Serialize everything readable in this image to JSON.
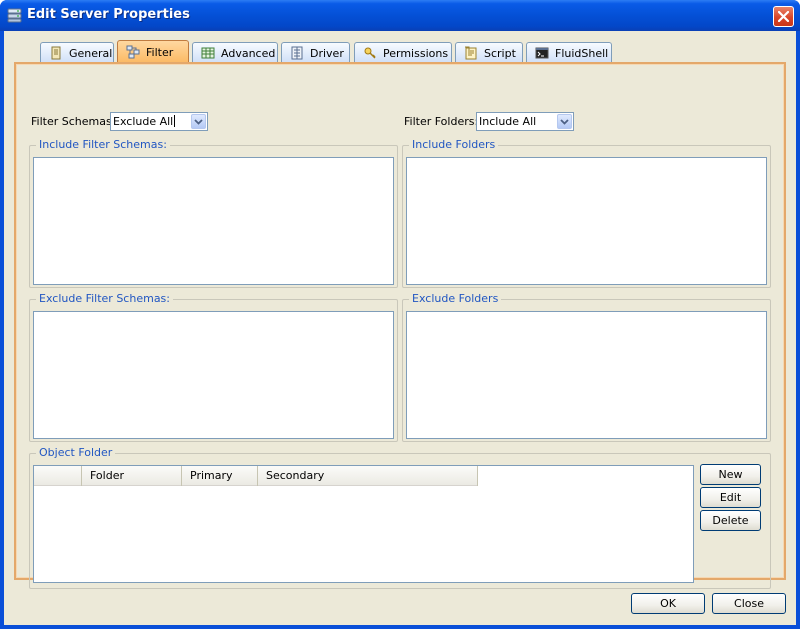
{
  "window": {
    "title": "Edit Server Properties"
  },
  "tabs": [
    {
      "label": "General",
      "icon": "general-icon"
    },
    {
      "label": "Filter",
      "icon": "filter-icon",
      "active": true
    },
    {
      "label": "Advanced",
      "icon": "advanced-icon"
    },
    {
      "label": "Driver",
      "icon": "driver-icon"
    },
    {
      "label": "Permissions",
      "icon": "permissions-icon"
    },
    {
      "label": "Script",
      "icon": "script-icon"
    },
    {
      "label": "FluidShell",
      "icon": "fluidshell-icon"
    }
  ],
  "filter": {
    "schemas_label": "Filter Schemas:",
    "schemas_value": "Exclude All",
    "folders_label": "Filter Folders:",
    "folders_value": "Include All"
  },
  "groups": {
    "include_schemas": "Include Filter Schemas:",
    "include_folders": "Include Folders",
    "exclude_schemas": "Exclude Filter Schemas:",
    "exclude_folders": "Exclude Folders",
    "object_folder": "Object Folder"
  },
  "object_table": {
    "columns": [
      "",
      "Folder",
      "Primary",
      "Secondary"
    ],
    "rows": []
  },
  "object_buttons": {
    "new": "New",
    "edit": "Edit",
    "delete": "Delete"
  },
  "footer": {
    "ok": "OK",
    "close": "Close"
  },
  "colors": {
    "titlebar": "#0a5be7",
    "active_tab": "#fbb963",
    "group_title": "#2156c2",
    "panel_border": "#e4a86a"
  }
}
